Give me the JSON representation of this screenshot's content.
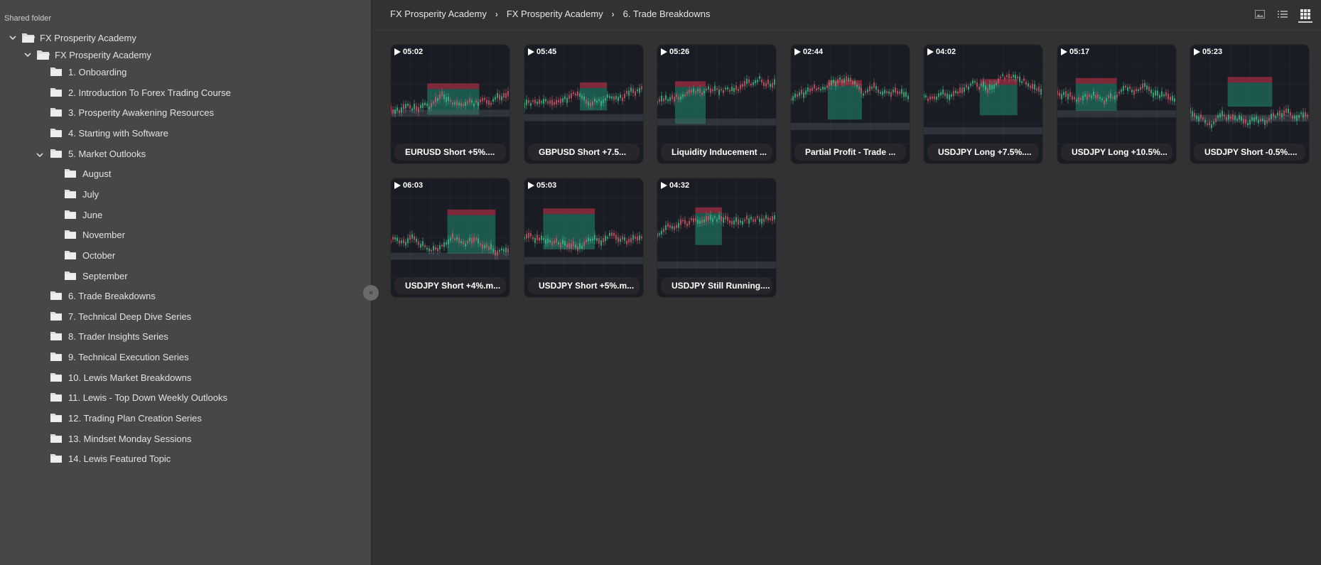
{
  "sidebar": {
    "shared_label": "Shared folder",
    "root": "FX Prosperity Academy",
    "child": "FX Prosperity Academy",
    "items": [
      "1. Onboarding",
      "2. Introduction To Forex Trading Course",
      "3. Prosperity Awakening Resources",
      "4. Starting with Software",
      "5. Market Outlooks",
      "August",
      "July",
      "June",
      "November",
      "October",
      "September",
      "6. Trade Breakdowns",
      "7. Technical Deep Dive Series",
      "8. Trader Insights Series",
      "9. Technical Execution Series",
      "10. Lewis Market Breakdowns",
      "11. Lewis - Top Down Weekly Outlooks",
      "12. Trading Plan Creation Series",
      "13. Mindset Monday Sessions",
      "14. Lewis Featured Topic"
    ],
    "collapse_icon": "chevrons-left-icon"
  },
  "breadcrumb": [
    "FX Prosperity Academy",
    "FX Prosperity Academy",
    "6. Trade Breakdowns"
  ],
  "view_icons": [
    "image-view-icon",
    "list-view-icon",
    "grid-view-icon"
  ],
  "videos": [
    {
      "duration": "05:02",
      "title": "EURUSD Short +5%...."
    },
    {
      "duration": "05:45",
      "title": "GBPUSD Short +7.5..."
    },
    {
      "duration": "05:26",
      "title": "Liquidity Inducement ..."
    },
    {
      "duration": "02:44",
      "title": "Partial Profit - Trade ..."
    },
    {
      "duration": "04:02",
      "title": "USDJPY Long +7.5%...."
    },
    {
      "duration": "05:17",
      "title": "USDJPY Long +10.5%..."
    },
    {
      "duration": "05:23",
      "title": "USDJPY Short -0.5%...."
    },
    {
      "duration": "06:03",
      "title": "USDJPY Short +4%.m..."
    },
    {
      "duration": "05:03",
      "title": "USDJPY Short +5%.m..."
    },
    {
      "duration": "04:32",
      "title": "USDJPY Still Running...."
    }
  ],
  "colors": {
    "sidebar_bg": "#474747",
    "content_bg": "#323232",
    "thumb_bg": "#1a1c24",
    "zone_green": "#1f8a70",
    "zone_red": "#c0324a"
  }
}
